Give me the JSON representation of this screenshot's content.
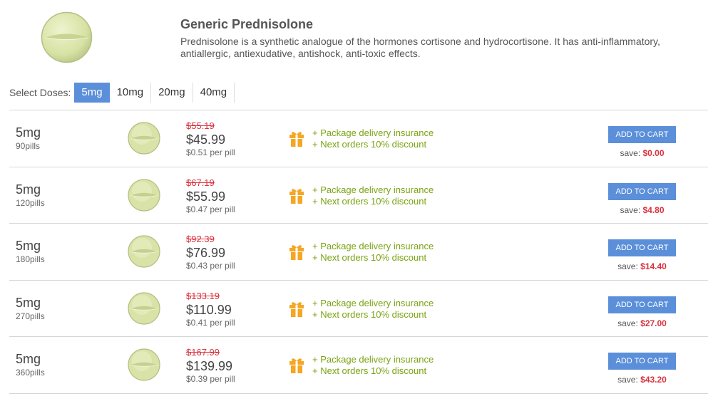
{
  "product": {
    "title": "Generic Prednisolone",
    "description": "Prednisolone is a synthetic analogue of the hormones cortisone and hydrocortisone. It has anti-inflammatory, antiallergic, antiexudative, antishock, anti-toxic effects."
  },
  "doses": {
    "label": "Select Doses:",
    "options": [
      "5mg",
      "10mg",
      "20mg",
      "40mg"
    ],
    "selected": "5mg"
  },
  "colors": {
    "accent": "#5b8fd9",
    "old_price": "#d9333f",
    "benefit": "#7aa312",
    "gift_icon": "#f5a623",
    "pill": "#dde7b0"
  },
  "offers": [
    {
      "dose": "5mg",
      "pills": "90pills",
      "old_price": "$55.19",
      "price": "$45.99",
      "per_pill": "$0.51 per pill",
      "benefit1": "+ Package delivery insurance",
      "benefit2": "+ Next orders 10% discount",
      "cart": "ADD TO CART",
      "save_label": "save:",
      "save_value": "$0.00"
    },
    {
      "dose": "5mg",
      "pills": "120pills",
      "old_price": "$67.19",
      "price": "$55.99",
      "per_pill": "$0.47 per pill",
      "benefit1": "+ Package delivery insurance",
      "benefit2": "+ Next orders 10% discount",
      "cart": "ADD TO CART",
      "save_label": "save:",
      "save_value": "$4.80"
    },
    {
      "dose": "5mg",
      "pills": "180pills",
      "old_price": "$92.39",
      "price": "$76.99",
      "per_pill": "$0.43 per pill",
      "benefit1": "+ Package delivery insurance",
      "benefit2": "+ Next orders 10% discount",
      "cart": "ADD TO CART",
      "save_label": "save:",
      "save_value": "$14.40"
    },
    {
      "dose": "5mg",
      "pills": "270pills",
      "old_price": "$133.19",
      "price": "$110.99",
      "per_pill": "$0.41 per pill",
      "benefit1": "+ Package delivery insurance",
      "benefit2": "+ Next orders 10% discount",
      "cart": "ADD TO CART",
      "save_label": "save:",
      "save_value": "$27.00"
    },
    {
      "dose": "5mg",
      "pills": "360pills",
      "old_price": "$167.99",
      "price": "$139.99",
      "per_pill": "$0.39 per pill",
      "benefit1": "+ Package delivery insurance",
      "benefit2": "+ Next orders 10% discount",
      "cart": "ADD TO CART",
      "save_label": "save:",
      "save_value": "$43.20"
    }
  ]
}
